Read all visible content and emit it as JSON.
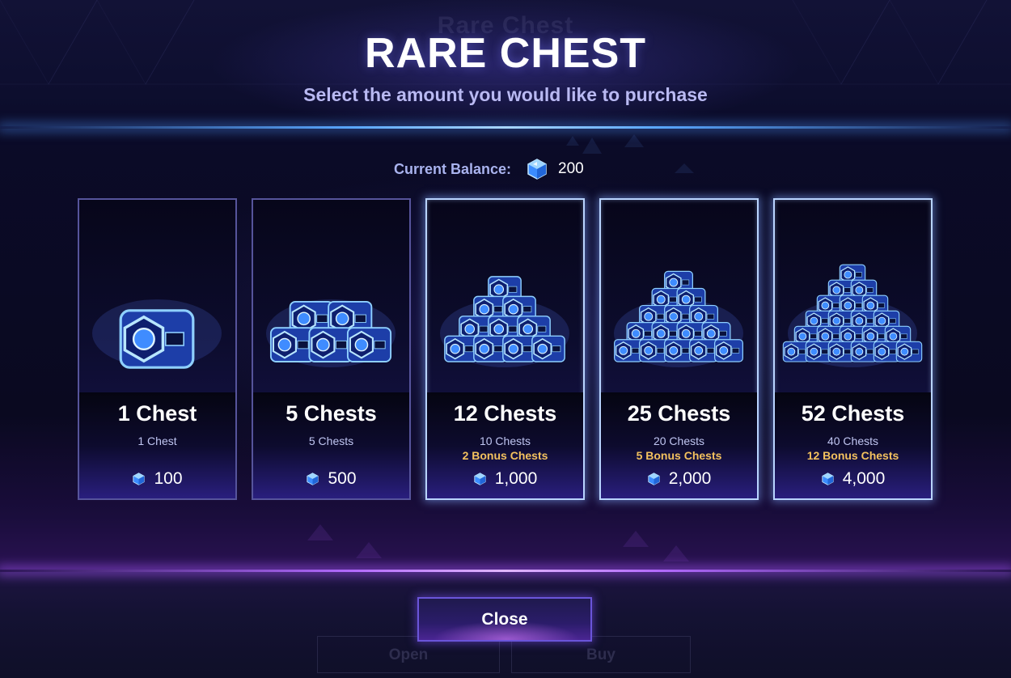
{
  "header": {
    "background_title": "Rare Chest",
    "title": "RARE CHEST",
    "subtitle": "Select the amount you would like to purchase"
  },
  "balance": {
    "label": "Current Balance:",
    "currency_icon": "gem-icon",
    "value": "200"
  },
  "options": [
    {
      "name": "1 Chest",
      "line1": "1 Chest",
      "line2": "",
      "price": "100",
      "stack_size": 1,
      "highlighted": false
    },
    {
      "name": "5 Chests",
      "line1": "5 Chests",
      "line2": "",
      "price": "500",
      "stack_size": 5,
      "highlighted": false
    },
    {
      "name": "12 Chests",
      "line1": "10 Chests",
      "line2": "2 Bonus Chests",
      "price": "1,000",
      "stack_size": 12,
      "highlighted": true
    },
    {
      "name": "25 Chests",
      "line1": "20 Chests",
      "line2": "5 Bonus Chests",
      "price": "2,000",
      "stack_size": 25,
      "highlighted": true
    },
    {
      "name": "52 Chests",
      "line1": "40 Chests",
      "line2": "12 Bonus Chests",
      "price": "4,000",
      "stack_size": 52,
      "highlighted": true
    }
  ],
  "footer": {
    "close_label": "Close",
    "background_open_label": "Open",
    "background_buy_label": "Buy"
  },
  "colors": {
    "accent_blue": "#5aa7ff",
    "accent_purple": "#b36bff",
    "bonus_text": "#f3c15e",
    "subtitle_text": "#b9b9f2"
  }
}
